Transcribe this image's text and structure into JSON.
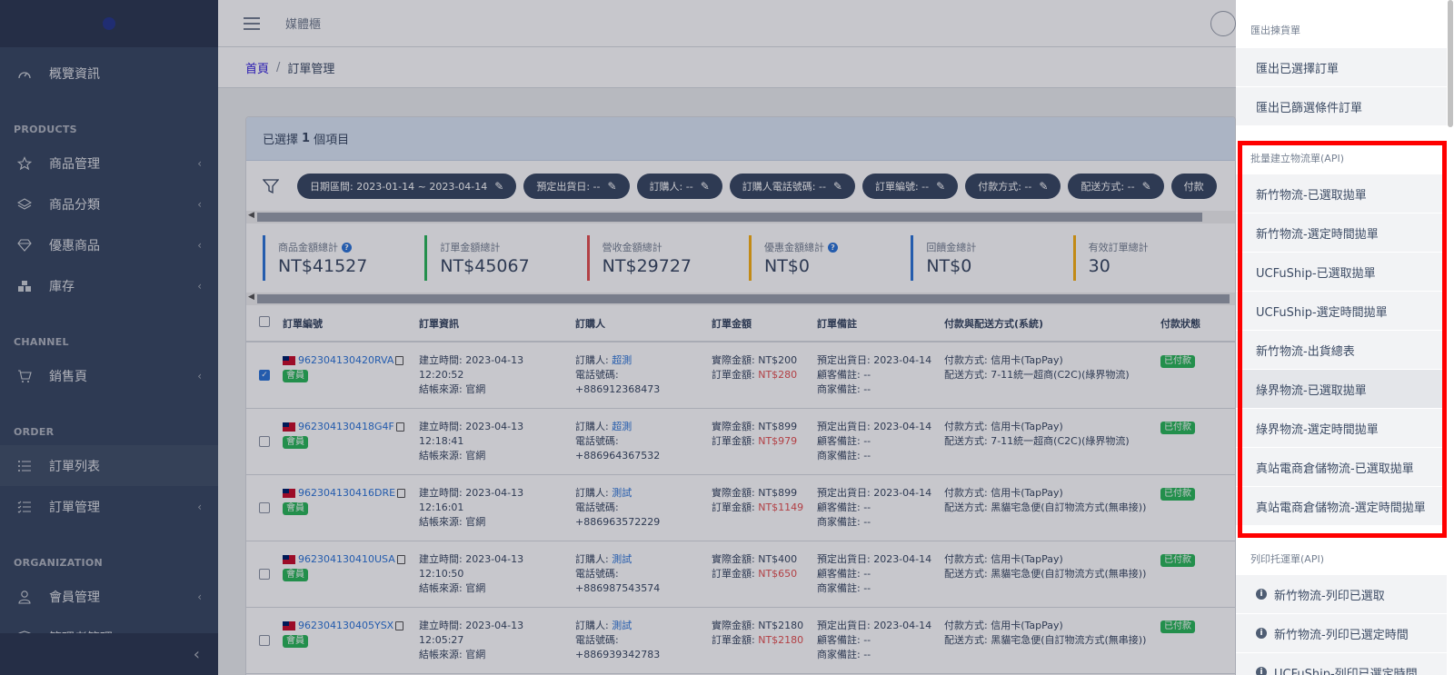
{
  "sidebar": {
    "dashboard": "概覽資訊",
    "sections": {
      "products": "PRODUCTS",
      "channel": "CHANNEL",
      "order": "ORDER",
      "organization": "ORGANIZATION"
    },
    "items": {
      "product_mgmt": "商品管理",
      "product_category": "商品分類",
      "discount_products": "優惠商品",
      "inventory": "庫存",
      "sales_page": "銷售頁",
      "order_list": "訂單列表",
      "order_mgmt": "訂單管理",
      "member_mgmt": "會員管理",
      "admin_mgmt": "管理者管理"
    }
  },
  "header": {
    "title": "媒體櫃"
  },
  "breadcrumb": {
    "home": "首頁",
    "current": "訂單管理"
  },
  "selection": {
    "prefix": "已選擇",
    "count": "1",
    "suffix": "個項目"
  },
  "filters": [
    "日期區間: 2023-01-14 ~ 2023-04-14",
    "預定出貨日: --",
    "訂購人: --",
    "訂購人電話號碼: --",
    "訂單編號: --",
    "付款方式: --",
    "配送方式: --",
    "付款"
  ],
  "stats": [
    {
      "label": "商品金額總計",
      "value": "NT$41527",
      "color": "#2f76d8",
      "help": true
    },
    {
      "label": "訂單金額總計",
      "value": "NT$45067",
      "color": "#2eb85c",
      "help": false
    },
    {
      "label": "營收金額總計",
      "value": "NT$29727",
      "color": "#e55353",
      "help": false
    },
    {
      "label": "優惠金額總計",
      "value": "NT$0",
      "color": "#f9b115",
      "help": true
    },
    {
      "label": "回饋金總計",
      "value": "NT$0",
      "color": "#2f76d8",
      "help": false
    },
    {
      "label": "有效訂單總計",
      "value": "30",
      "color": "#f9b115",
      "help": false
    }
  ],
  "table": {
    "headers": [
      "訂單編號",
      "訂單資訊",
      "訂購人",
      "訂單金額",
      "訂單備註",
      "付款與配送方式(系統)",
      "付款狀態"
    ],
    "member_badge": "會員",
    "rows": [
      {
        "checked": true,
        "order_no": "962304130420RVA",
        "created": "建立時間: 2023-04-13 12:20:52",
        "source": "結帳來源: 官網",
        "buyer_label": "訂購人:",
        "buyer": "超測",
        "phone": "電話號碼: +886912368473",
        "actual_label": "實際金額:",
        "actual": "NT$200",
        "total_label": "訂單金額:",
        "total": "NT$280",
        "ship_date": "預定出貨日: 2023-04-14",
        "cust_note": "顧客備註: --",
        "merchant_note": "商家備註: --",
        "pay_method": "付款方式: 信用卡(TapPay)",
        "delivery": "配送方式: 7-11統一超商(C2C)(綠界物流)",
        "status": "已付款"
      },
      {
        "checked": false,
        "order_no": "962304130418G4F",
        "created": "建立時間: 2023-04-13 12:18:41",
        "source": "結帳來源: 官網",
        "buyer_label": "訂購人:",
        "buyer": "超測",
        "phone": "電話號碼: +886964367532",
        "actual_label": "實際金額:",
        "actual": "NT$899",
        "total_label": "訂單金額:",
        "total": "NT$979",
        "ship_date": "預定出貨日: 2023-04-14",
        "cust_note": "顧客備註: --",
        "merchant_note": "商家備註: --",
        "pay_method": "付款方式: 信用卡(TapPay)",
        "delivery": "配送方式: 7-11統一超商(C2C)(綠界物流)",
        "status": "已付款"
      },
      {
        "checked": false,
        "order_no": "962304130416DRE",
        "created": "建立時間: 2023-04-13 12:16:01",
        "source": "結帳來源: 官網",
        "buyer_label": "訂購人:",
        "buyer": "測試",
        "phone": "電話號碼: +886963572229",
        "actual_label": "實際金額:",
        "actual": "NT$899",
        "total_label": "訂單金額:",
        "total": "NT$1149",
        "ship_date": "預定出貨日: 2023-04-14",
        "cust_note": "顧客備註: --",
        "merchant_note": "商家備註: --",
        "pay_method": "付款方式: 信用卡(TapPay)",
        "delivery": "配送方式: 黑貓宅急便(自訂物流方式(無串接))",
        "status": "已付款"
      },
      {
        "checked": false,
        "order_no": "962304130410USA",
        "created": "建立時間: 2023-04-13 12:10:50",
        "source": "結帳來源: 官網",
        "buyer_label": "訂購人:",
        "buyer": "測試",
        "phone": "電話號碼: +886987543574",
        "actual_label": "實際金額:",
        "actual": "NT$400",
        "total_label": "訂單金額:",
        "total": "NT$650",
        "ship_date": "預定出貨日: 2023-04-14",
        "cust_note": "顧客備註: --",
        "merchant_note": "商家備註: --",
        "pay_method": "付款方式: 信用卡(TapPay)",
        "delivery": "配送方式: 黑貓宅急便(自訂物流方式(無串接))",
        "status": "已付款"
      },
      {
        "checked": false,
        "order_no": "962304130405YSX",
        "created": "建立時間: 2023-04-13 12:05:27",
        "source": "結帳來源: 官網",
        "buyer_label": "訂購人:",
        "buyer": "測試",
        "phone": "電話號碼: +886939342783",
        "actual_label": "實際金額:",
        "actual": "NT$2180",
        "total_label": "訂單金額:",
        "total": "NT$2180",
        "ship_date": "預定出貨日: 2023-04-14",
        "cust_note": "顧客備註: --",
        "merchant_note": "商家備註: --",
        "pay_method": "付款方式: 信用卡(TapPay)",
        "delivery": "配送方式: 黑貓宅急便(自訂物流方式(無串接))",
        "status": "已付款"
      }
    ]
  },
  "menu": {
    "export_header": "匯出揀貨單",
    "export_items": [
      "匯出已選擇訂單",
      "匯出已篩選條件訂單"
    ],
    "batch_header": "批量建立物流單(API)",
    "batch_items": [
      "新竹物流-已選取拋單",
      "新竹物流-選定時間拋單",
      "UCFuShip-已選取拋單",
      "UCFuShip-選定時間拋單",
      "新竹物流-出貨總表",
      "綠界物流-已選取拋單",
      "綠界物流-選定時間拋單",
      "真站電商倉儲物流-已選取拋單",
      "真站電商倉儲物流-選定時間拋單"
    ],
    "print_header": "列印托運單(API)",
    "print_items": [
      "新竹物流-列印已選取",
      "新竹物流-列印已選定時間",
      "UCFuShip-列印已選定時間"
    ]
  }
}
